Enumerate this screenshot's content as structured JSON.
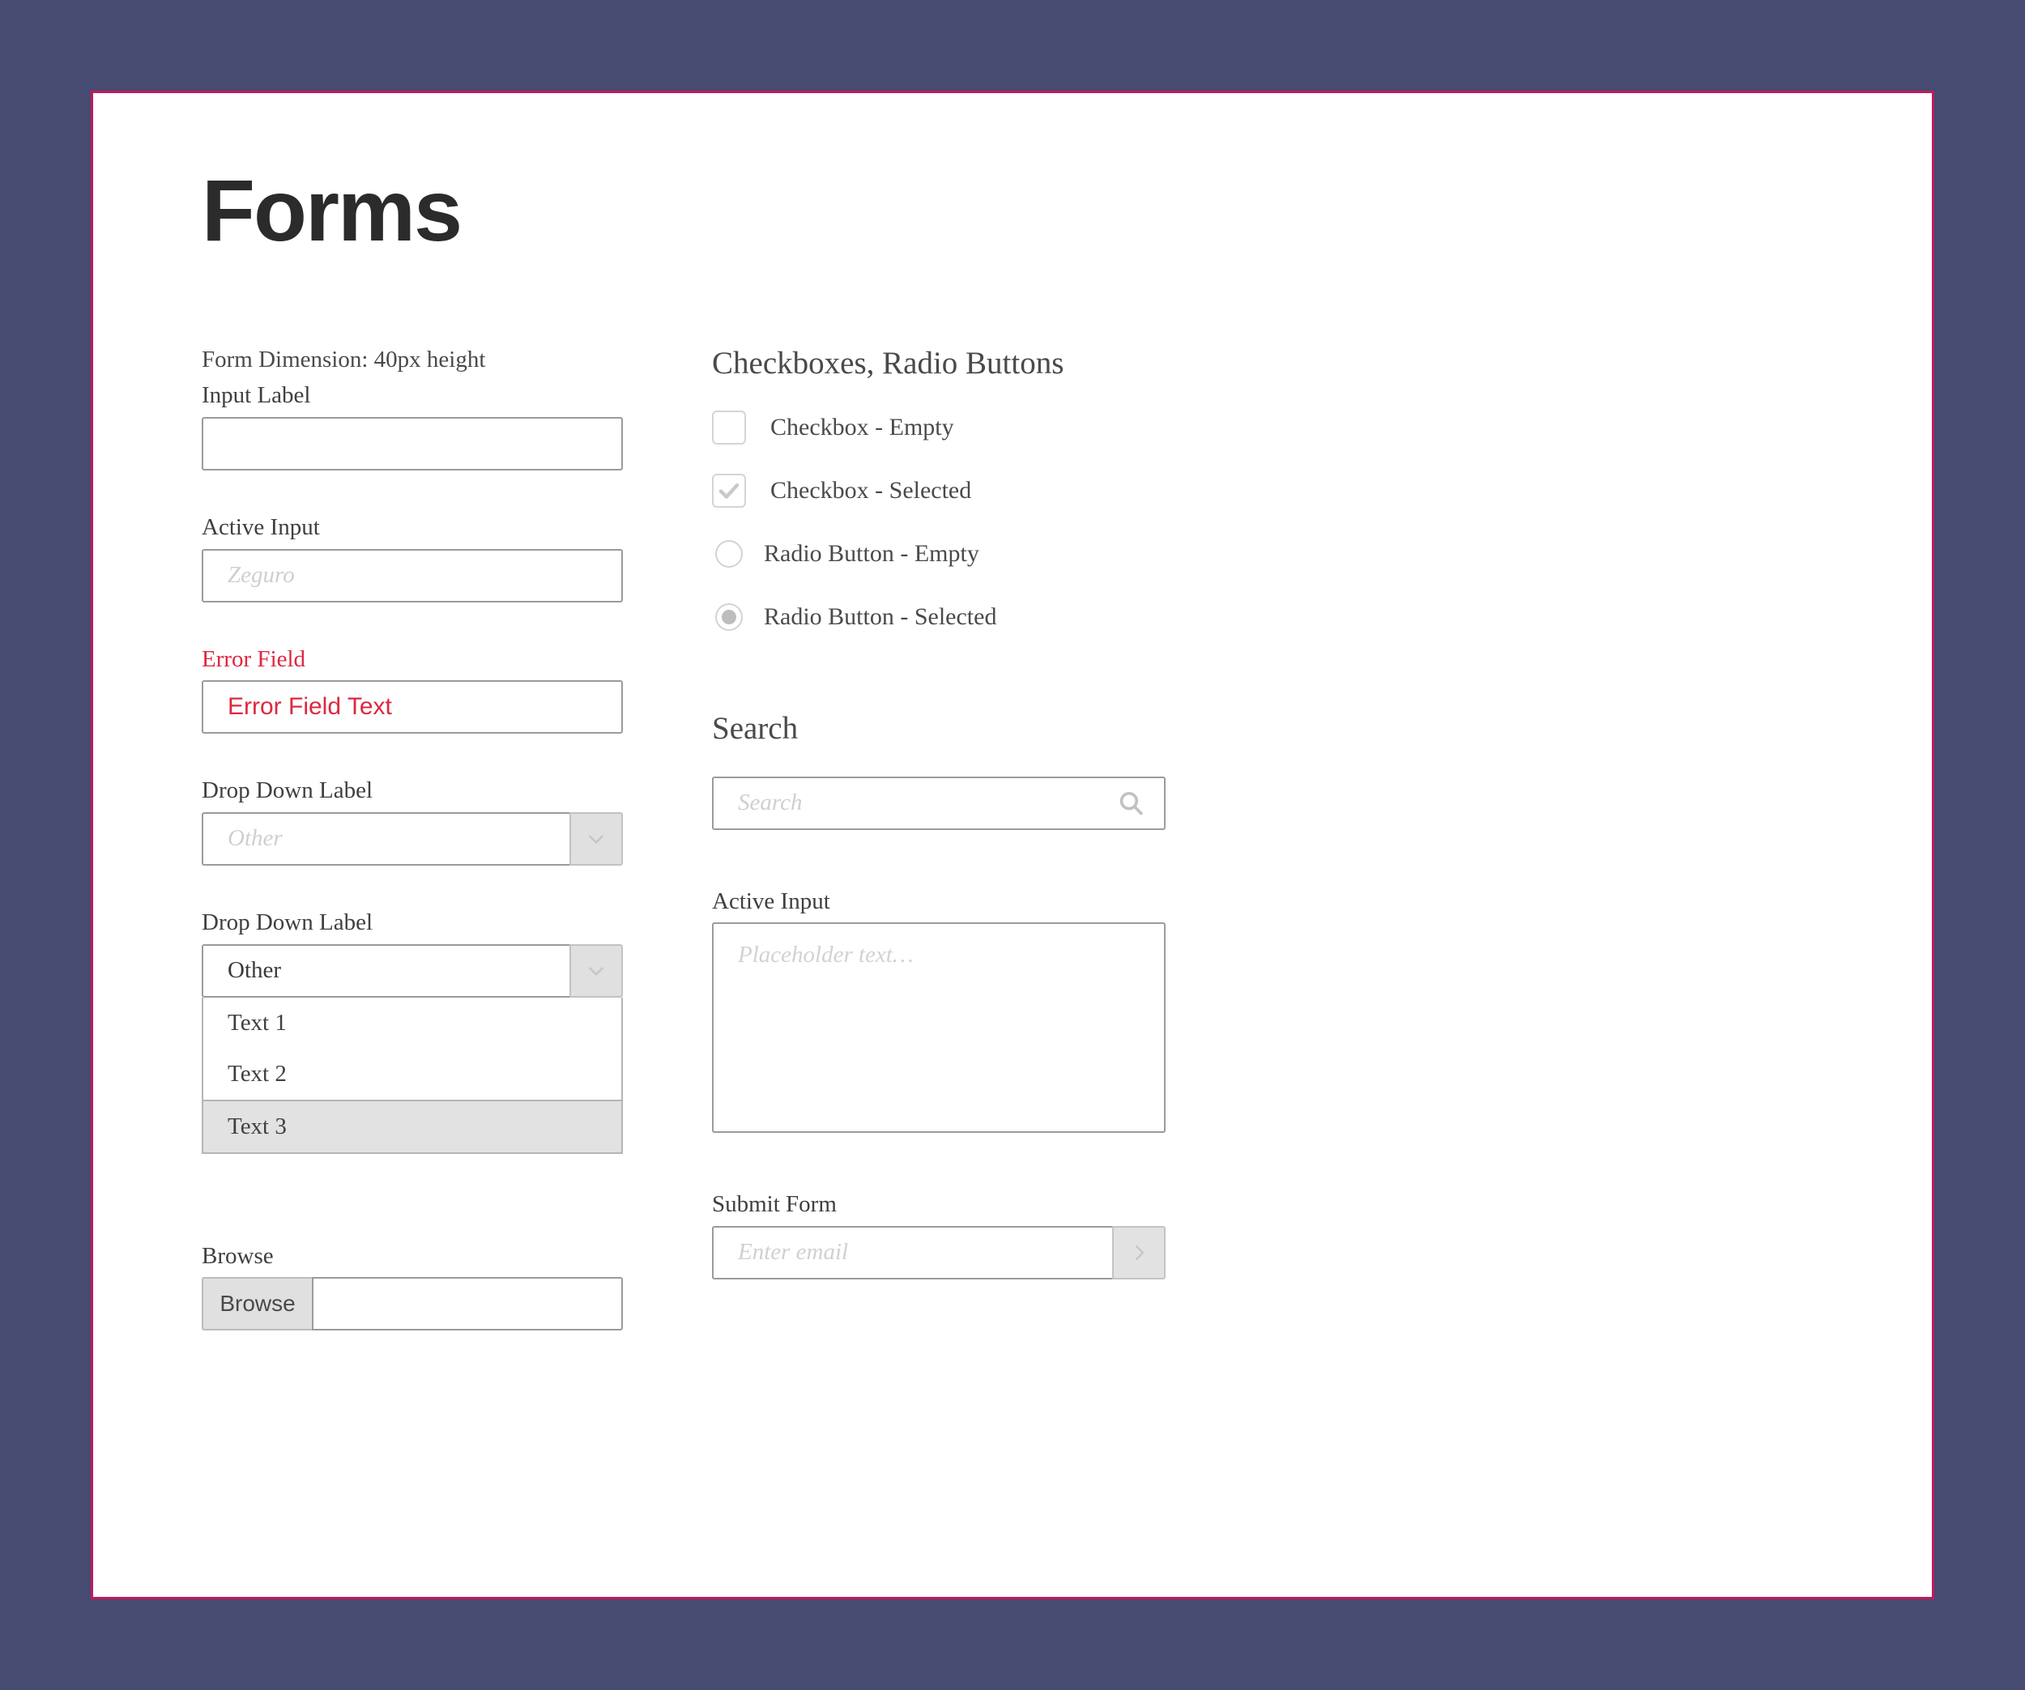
{
  "theme": {
    "background": "#474b72",
    "card_border": "#bf1b5e",
    "card_background": "#ffffff",
    "error_color": "#dd2840",
    "text_color": "#4a4a4a",
    "placeholder_color": "#cfcfcf",
    "control_grey": "#e0e0e0",
    "border_grey": "#9b9b9b"
  },
  "page": {
    "title": "Forms"
  },
  "left_column": {
    "dimension_note": "Form Dimension: 40px height",
    "input_label": "Input Label",
    "input_value": "",
    "active_input": {
      "label": "Active Input",
      "placeholder": "Zeguro",
      "value": ""
    },
    "error_field": {
      "label": "Error Field",
      "value": "Error Field Text"
    },
    "dropdown_empty": {
      "label": "Drop Down Label",
      "placeholder": "Other",
      "value": "",
      "chevron_icon": "chevron-down-icon"
    },
    "dropdown_open": {
      "label": "Drop Down Label",
      "value": "Other",
      "chevron_icon": "chevron-down-icon",
      "options": [
        {
          "label": "Text 1",
          "highlighted": false
        },
        {
          "label": "Text 2",
          "highlighted": false
        },
        {
          "label": "Text 3",
          "highlighted": true
        }
      ]
    },
    "browse": {
      "label": "Browse",
      "button_label": "Browse",
      "value": ""
    }
  },
  "right_column": {
    "choices_heading": "Checkboxes, Radio Buttons",
    "choices": [
      {
        "type": "checkbox",
        "label": "Checkbox - Empty",
        "checked": false
      },
      {
        "type": "checkbox",
        "label": "Checkbox - Selected",
        "checked": true
      },
      {
        "type": "radio",
        "label": "Radio Button - Empty",
        "checked": false
      },
      {
        "type": "radio",
        "label": "Radio Button - Selected",
        "checked": true
      }
    ],
    "search": {
      "heading": "Search",
      "placeholder": "Search",
      "value": "",
      "icon": "search-icon"
    },
    "textarea": {
      "label": "Active Input",
      "placeholder": "Placeholder text…",
      "value": ""
    },
    "submit": {
      "label": "Submit Form",
      "placeholder": "Enter email",
      "value": "",
      "button_icon": "chevron-right-icon"
    }
  }
}
